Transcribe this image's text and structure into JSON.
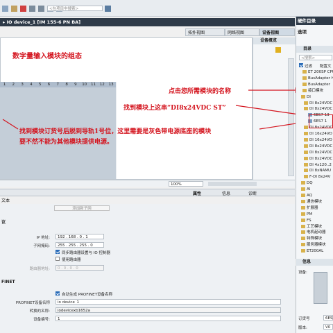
{
  "toolbar": {
    "search_placeholder": "<在项目中搜索>"
  },
  "device_header": "▸ IO device_1 [IM 155-6 PN BA]",
  "view_tabs": {
    "topology": "拓扑视图",
    "network": "网络视图",
    "device": "设备视图"
  },
  "device_overview_tab": "设备概览",
  "catalog": {
    "title": "硬件目录",
    "options": "选项",
    "section": "目录",
    "search_placeholder": "<搜索>",
    "filter_label": "过滤",
    "profile_label": "配置文",
    "info_section": "信息",
    "device_label": "设备:",
    "order_label": "订货号",
    "order_value": "6ES",
    "version_label": "版本:",
    "version_value": "V0",
    "tree": [
      {
        "label": "ET 200SP CPU",
        "type": "folder"
      },
      {
        "label": "BusAdapter H",
        "type": "folder"
      },
      {
        "label": "BusAdapter",
        "type": "folder"
      },
      {
        "label": "接口模块",
        "type": "folder"
      },
      {
        "label": "DI",
        "type": "folder"
      },
      {
        "label": "DI 8x24VDC",
        "type": "folder"
      },
      {
        "label": "DI 8x24VDC",
        "type": "folder"
      },
      {
        "label": "6ES7 13",
        "type": "item"
      },
      {
        "label": "6ES7 1",
        "type": "item"
      },
      {
        "label": "DI 8x24VDC",
        "type": "folder"
      },
      {
        "label": "DI 16x24VD",
        "type": "folder"
      },
      {
        "label": "DI 16x24VD",
        "type": "folder"
      },
      {
        "label": "DI 8x24VDC",
        "type": "folder"
      },
      {
        "label": "DI 8x24VDC",
        "type": "folder"
      },
      {
        "label": "DI 8x24VDC",
        "type": "folder"
      },
      {
        "label": "DI 4x120..2",
        "type": "folder"
      },
      {
        "label": "DI 8xNAMU",
        "type": "folder"
      },
      {
        "label": "F-DI 8x24V",
        "type": "folder"
      },
      {
        "label": "DQ",
        "type": "folder"
      },
      {
        "label": "AI",
        "type": "folder"
      },
      {
        "label": "AQ",
        "type": "folder"
      },
      {
        "label": "通信模块",
        "type": "folder"
      },
      {
        "label": "扩展器",
        "type": "folder"
      },
      {
        "label": "PM",
        "type": "folder"
      },
      {
        "label": "FS",
        "type": "folder"
      },
      {
        "label": "工艺模块",
        "type": "folder"
      },
      {
        "label": "电机起动器",
        "type": "folder"
      },
      {
        "label": "特殊模块",
        "type": "folder"
      },
      {
        "label": "服务器模块",
        "type": "folder"
      },
      {
        "label": "ET200AL",
        "type": "folder"
      }
    ]
  },
  "annotations": {
    "title": "数字量输入模块的组态",
    "click_module": "点击您所需模块的名称",
    "find_module": "找到模块上这串“DI8x24VDC ST”",
    "find_order": "找到模块订货号后脱到导轨1号位，这里需要是灰色带电源底座的模块",
    "otherwise": "要不然不能为其他模块提供电源。"
  },
  "slot_numbers": [
    "1",
    "2",
    "3",
    "4",
    "5",
    "6",
    "7",
    "8",
    "9",
    "10",
    "11",
    "12",
    "13"
  ],
  "zoom": "100%",
  "inspector_tabs": {
    "properties": "属性",
    "info": "信息",
    "diagnostics": "诊断"
  },
  "left_tab": "文本",
  "add_subnet_button": "添加新子网",
  "ip_section": "议",
  "ip": {
    "ip_label": "IP 地址:",
    "ip_value": "192 . 168 . 0 . 1",
    "mask_label": "子网掩码:",
    "mask_value": "255 . 255 . 255 . 0",
    "sync_router": "同步路由器设置与 IO 控制器",
    "use_router": "使用路由器",
    "router_label": "路由器地址:",
    "router_value": "0 . 0 . 0 . 0"
  },
  "profinet_section": "FINET",
  "profinet": {
    "auto_name": "自动生成 PROFINET设备名称",
    "name_label": "PROFINET设备名称",
    "name_value": "io device_1",
    "converted_label": "转换的名称:",
    "converted_value": "iodevicexb1652a",
    "number_label": "设备编号:",
    "number_value": "1"
  }
}
